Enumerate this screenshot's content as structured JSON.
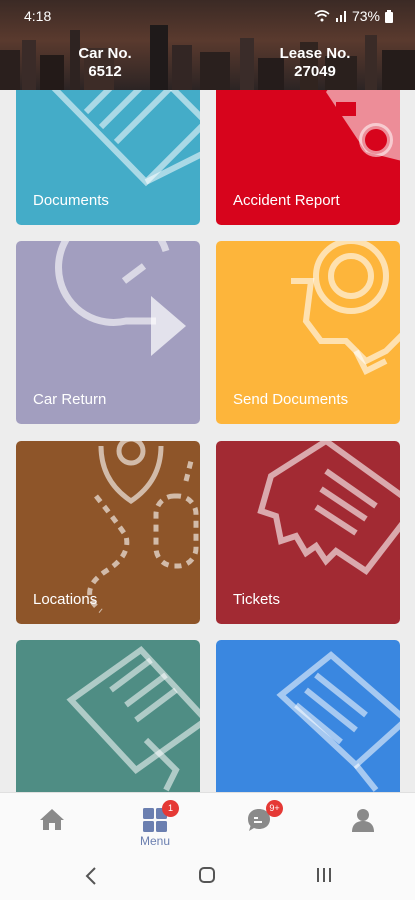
{
  "status": {
    "time": "4:18",
    "battery": "73%"
  },
  "header": {
    "car_label": "Car No.",
    "car_value": "6512",
    "lease_label": "Lease No.",
    "lease_value": "27049"
  },
  "tiles": [
    {
      "label": "Documents",
      "color": "#44acc8",
      "icon": "documents-icon"
    },
    {
      "label": "Accident Report",
      "color": "#d7041c",
      "icon": "car-crash-icon"
    },
    {
      "label": "Car Return",
      "color": "#a29ebf",
      "icon": "return-arrow-icon"
    },
    {
      "label": "Send Documents",
      "color": "#fdb53b",
      "icon": "gear-document-icon"
    },
    {
      "label": "Locations",
      "color": "#8e5529",
      "icon": "location-map-icon"
    },
    {
      "label": "Tickets",
      "color": "#a22a33",
      "icon": "ticket-icon"
    },
    {
      "label": "",
      "color": "#4f8d84",
      "icon": "contract-sign-icon"
    },
    {
      "label": "",
      "color": "#3a87e0",
      "icon": "receipt-icon"
    }
  ],
  "nav": {
    "home_icon": "home-icon",
    "menu_label": "Menu",
    "menu_badge": "1",
    "chat_badge": "9+",
    "profile_icon": "profile-icon"
  },
  "colors": {
    "nav_active": "#6b7fb0",
    "nav_inactive": "#8a8a8a",
    "badge": "#e53935"
  }
}
